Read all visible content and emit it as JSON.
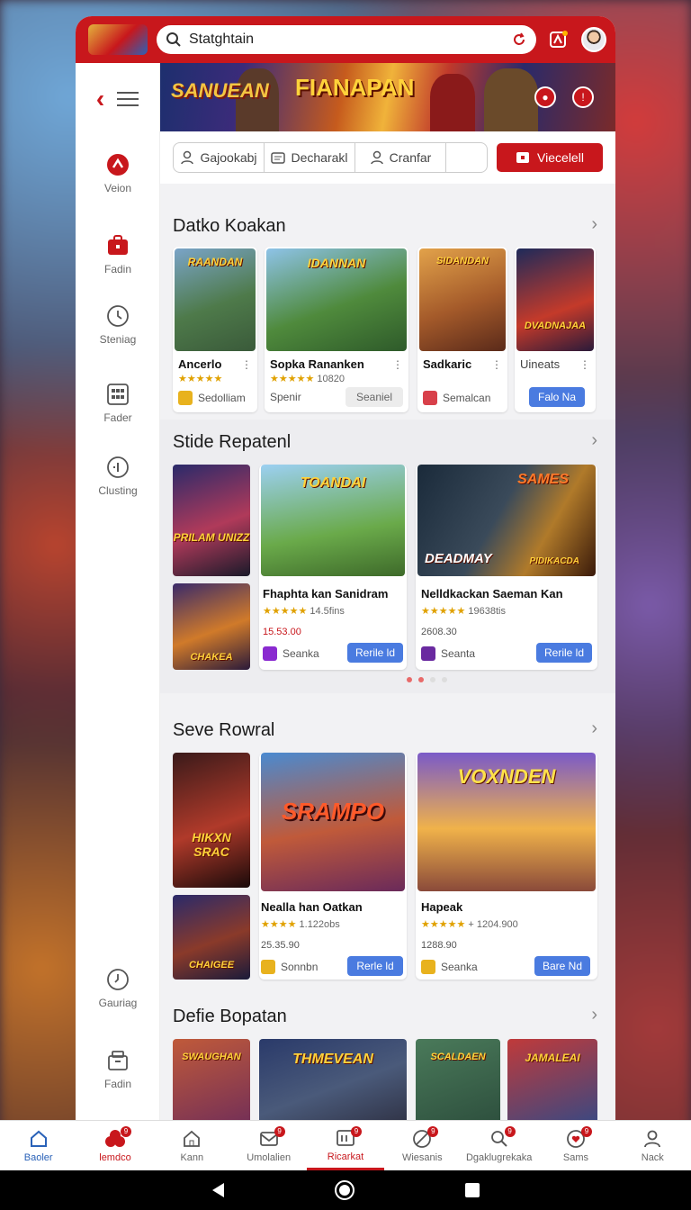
{
  "header": {
    "logo_text": "",
    "search_value": "Statghtain"
  },
  "banner": {
    "left_title": "SANUEAN",
    "main_title": "FIANAPAN"
  },
  "filters": {
    "tabs": [
      {
        "label": "Gajookabj",
        "icon": "user-icon"
      },
      {
        "label": "Decharakl",
        "icon": "card-icon"
      },
      {
        "label": "Cranfar",
        "icon": "user-icon"
      }
    ],
    "primary_button": "Viecelell"
  },
  "side_nav": [
    {
      "label": "Veion",
      "icon": "warning-icon"
    },
    {
      "label": "Fadin",
      "icon": "briefcase-icon"
    },
    {
      "label": "Steniag",
      "icon": "dial-icon"
    },
    {
      "label": "Fader",
      "icon": "grid-icon"
    },
    {
      "label": "Clusting",
      "icon": "info-icon"
    },
    {
      "label": "Gauriag",
      "icon": "clock-icon"
    },
    {
      "label": "Fadin",
      "icon": "archive-icon"
    }
  ],
  "sections": [
    {
      "title": "Datko Koakan",
      "cards": [
        {
          "title": "Ancerlo",
          "stars": "★★★★★",
          "foot": "Sedolliam",
          "art_text": "RAANDAN"
        },
        {
          "title": "Sopka Rananken",
          "stars": "★★★★★",
          "rating_text": "10820",
          "button": "Spenir",
          "foot_button": "Seaniel",
          "art_text": "IDANNAN"
        },
        {
          "title": "Sadkaric",
          "foot": "Semalcan",
          "art_text": "SIDANDAN"
        },
        {
          "title": "Uineats",
          "button": "Falo Na",
          "art_text": "DVADNAJAA"
        }
      ]
    },
    {
      "title": "Stide Repatenl",
      "cards": [
        {
          "title": "Fhaphta kan Sanidram",
          "stars": "★★★★★",
          "rating_text": "14.5fins",
          "price": "15.53.00",
          "foot": "Seanka",
          "button": "Rerile ld",
          "art_text": "TOANDAI"
        },
        {
          "title": "Nelldkackan Saeman Kan",
          "stars": "★★★★★",
          "rating_text": "19638tis",
          "price": "2608.30",
          "foot": "Seanta",
          "button": "Rerile ld",
          "art_text": "DEADMAY"
        }
      ],
      "posters": [
        "PRILAM UNIZZ",
        "CHAKEA"
      ],
      "extra_art": "SAMES",
      "extra_art2": "PIDIKACDA"
    },
    {
      "title": "Seve Rowral",
      "cards": [
        {
          "title": "Nealla han Oatkan",
          "stars": "★★★★",
          "rating_text": "1.122obs",
          "price": "25.35.90",
          "foot": "Sonnbn",
          "button": "Rerle ld",
          "art_text": "SRAMPO"
        },
        {
          "title": "Hapeak",
          "stars": "★★★★★",
          "rating_text": "+ 1204.900",
          "price": "1288.90",
          "foot": "Seanka",
          "button": "Bare Nd",
          "art_text": "VOXNDEN"
        }
      ],
      "posters": [
        "HIKXN SRAC",
        "CHAIGEE"
      ]
    },
    {
      "title": "Defie Bopatan",
      "art": [
        "SWAUGHAN",
        "THMEVEAN",
        "SCALDAEN",
        "JAMALEAI"
      ]
    }
  ],
  "bottom_nav": [
    {
      "label": "Baoler",
      "icon": "home-icon",
      "badge": ""
    },
    {
      "label": "lemdco",
      "icon": "berries-icon",
      "badge": "9"
    },
    {
      "label": "Kann",
      "icon": "home-outline-icon",
      "badge": ""
    },
    {
      "label": "Umolalien",
      "icon": "mail-icon",
      "badge": "9"
    },
    {
      "label": "Ricarkat",
      "icon": "box-icon",
      "badge": "9"
    },
    {
      "label": "Wiesanis",
      "icon": "no-entry-icon",
      "badge": "9"
    },
    {
      "label": "Dgaklugrekaka",
      "icon": "search-gear-icon",
      "badge": "9"
    },
    {
      "label": "Sams",
      "icon": "heart-icon",
      "badge": "9"
    },
    {
      "label": "Nack",
      "icon": "person-icon",
      "badge": ""
    }
  ],
  "colors": {
    "brand": "#c8171c",
    "accent_blue": "#4a7be0",
    "active_nav": "#2a62b8"
  }
}
